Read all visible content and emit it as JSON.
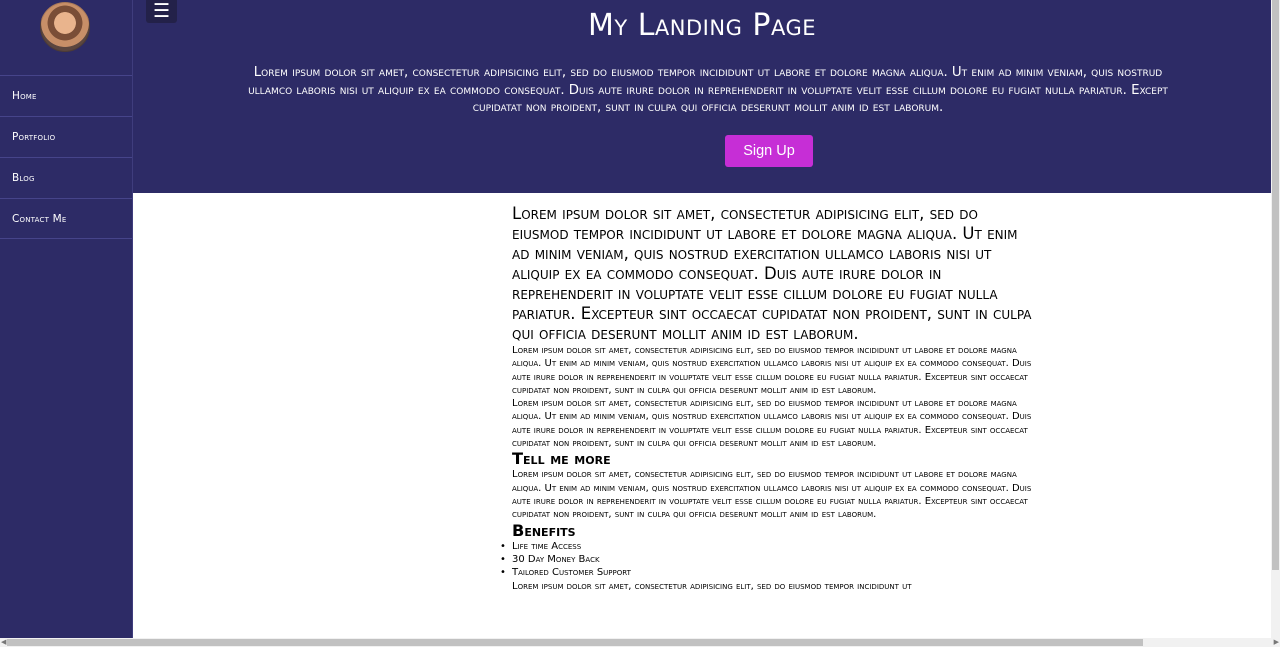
{
  "sidebar": {
    "items": [
      {
        "label": "Home"
      },
      {
        "label": "Portfolio"
      },
      {
        "label": "Blog"
      },
      {
        "label": "Contact Me"
      }
    ]
  },
  "header": {
    "menu_icon": "☰",
    "title": "My Landing Page",
    "lines": [
      "Lorem ipsum dolor sit amet, consectetur adipisicing elit, sed do eiusmod tempor incididunt ut labore et dolore magna aliqua. Ut enim ad minim veniam, quis nostrud",
      "ullamco laboris nisi ut aliquip ex ea commodo consequat. Duis aute irure dolor in reprehenderit in voluptate velit esse cillum dolore eu fugiat nulla pariatur. Except",
      "cupidatat non proident, sunt in culpa qui officia deserunt mollit anim id est laborum."
    ],
    "signup_label": "Sign Up"
  },
  "main": {
    "lead": "Lorem ipsum dolor sit amet, consectetur adipisicing elit, sed do eiusmod tempor incididunt ut labore et dolore magna aliqua. Ut enim ad minim veniam, quis nostrud exercitation ullamco laboris nisi ut aliquip ex ea commodo consequat. Duis aute irure dolor in reprehenderit in voluptate velit esse cillum dolore eu fugiat nulla pariatur. Excepteur sint occaecat cupidatat non proident, sunt in culpa qui officia deserunt mollit anim id est laborum.",
    "para1": "Lorem ipsum dolor sit amet, consectetur adipisicing elit, sed do eiusmod tempor incididunt ut labore et dolore magna aliqua. Ut enim ad minim veniam, quis nostrud exercitation ullamco laboris nisi ut aliquip ex ea commodo consequat. Duis aute irure dolor in reprehenderit in voluptate velit esse cillum dolore eu fugiat nulla pariatur. Excepteur sint occaecat cupidatat non proident, sunt in culpa qui officia deserunt mollit anim id est laborum.",
    "para2": "Lorem ipsum dolor sit amet, consectetur adipisicing elit, sed do eiusmod tempor incididunt ut labore et dolore magna aliqua. Ut enim ad minim veniam, quis nostrud exercitation ullamco laboris nisi ut aliquip ex ea commodo consequat. Duis aute irure dolor in reprehenderit in voluptate velit esse cillum dolore eu fugiat nulla pariatur. Excepteur sint occaecat cupidatat non proident, sunt in culpa qui officia deserunt mollit anim id est laborum.",
    "tell_heading": "Tell me more",
    "para3": "Lorem ipsum dolor sit amet, consectetur adipisicing elit, sed do eiusmod tempor incididunt ut labore et dolore magna aliqua. Ut enim ad minim veniam, quis nostrud exercitation ullamco laboris nisi ut aliquip ex ea commodo consequat. Duis aute irure dolor in reprehenderit in voluptate velit esse cillum dolore eu fugiat nulla pariatur. Excepteur sint occaecat cupidatat non proident, sunt in culpa qui officia deserunt mollit anim id est laborum.",
    "benefits_heading": "Benefits",
    "benefits": [
      "Life time Access",
      "30 Day Money Back",
      "Tailored Customer Support"
    ],
    "para4": "Lorem ipsum dolor sit amet, consectetur adipisicing elit, sed do eiusmod tempor incididunt ut"
  },
  "colors": {
    "sidebar_bg": "#2d2b66",
    "hero_bg": "#2d2b66",
    "signup_bg": "#c62ed6"
  }
}
